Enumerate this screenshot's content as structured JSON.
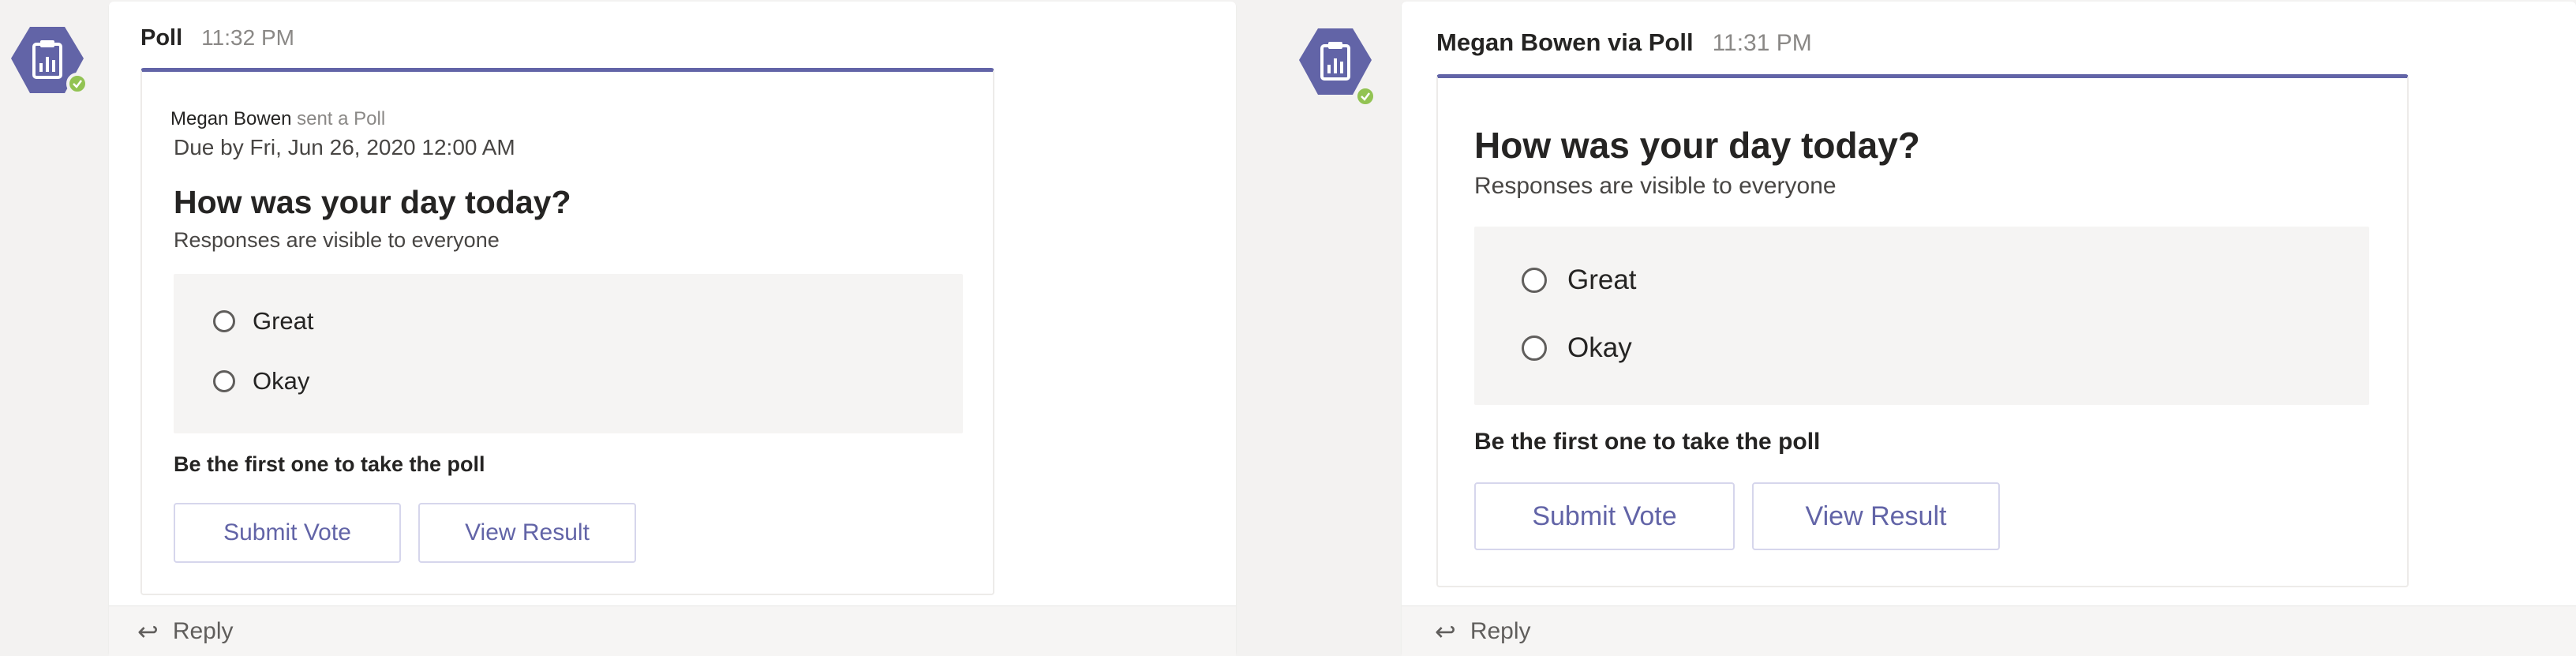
{
  "left": {
    "sender": "Poll",
    "time": "11:32 PM",
    "sent_by_name": "Megan Bowen",
    "sent_by_action": "sent a Poll",
    "due": "Due by Fri, Jun 26, 2020 12:00 AM",
    "question": "How was your day today?",
    "subtitle": "Responses are visible to everyone",
    "options": [
      "Great",
      "Okay"
    ],
    "cta": "Be the first one to take the poll",
    "submit_label": "Submit Vote",
    "view_label": "View Result",
    "reply_label": "Reply"
  },
  "right": {
    "sender": "Megan Bowen via Poll",
    "time": "11:31 PM",
    "question": "How was your day today?",
    "subtitle": "Responses are visible to everyone",
    "options": [
      "Great",
      "Okay"
    ],
    "cta": "Be the first one to take the poll",
    "submit_label": "Submit Vote",
    "view_label": "View Result",
    "reply_label": "Reply"
  },
  "icons": {
    "bot_avatar": "poll-clipboard-icon",
    "status": "available-check-icon",
    "reply": "reply-arrow-icon"
  },
  "colors": {
    "accent": "#6264a7",
    "status_green": "#92c353",
    "background": "#f3f2f1"
  }
}
